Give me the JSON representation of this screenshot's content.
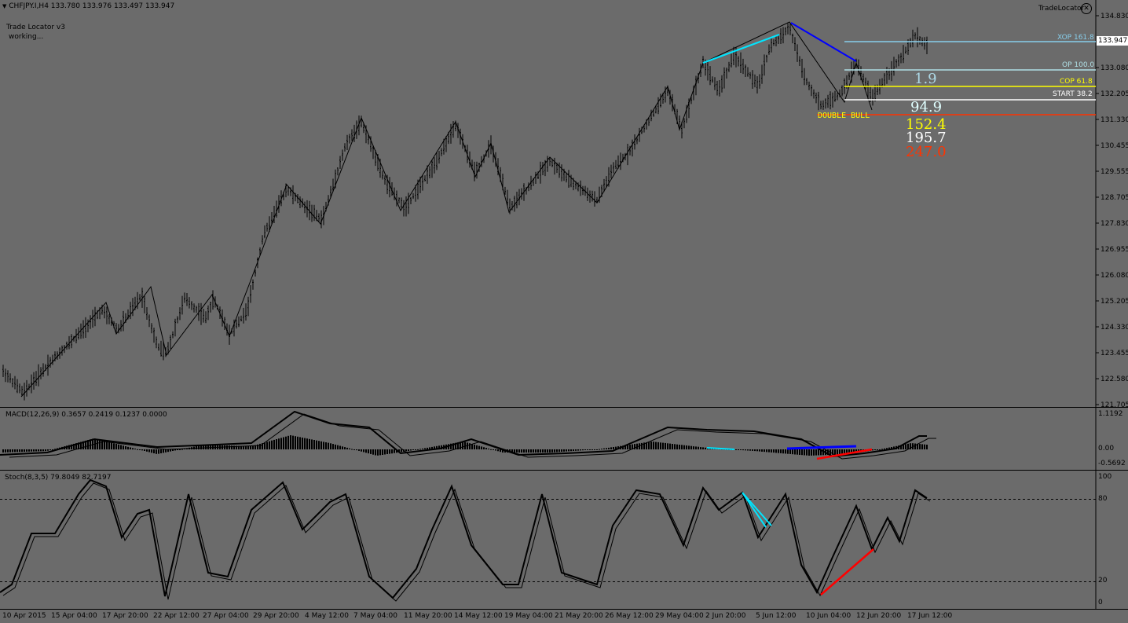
{
  "header": {
    "symbol_line": "CHFJPY.I,H4  133.780 133.976 133.497 133.947",
    "indicator_name": "Trade Locator v3",
    "indicator_status": "working...",
    "tradelocator_label": "TradeLocator"
  },
  "price_axis": {
    "ticks": [
      "134.830",
      "133.080",
      "132.205",
      "131.330",
      "130.455",
      "129.555",
      "128.705",
      "127.830",
      "126.955",
      "126.080",
      "125.205",
      "124.330",
      "123.455",
      "122.580",
      "121.705"
    ],
    "current_price": "133.947",
    "current_price_bg": "#ffffff"
  },
  "levels": [
    {
      "label": "XOP 161.8",
      "color": "#87ceeb"
    },
    {
      "label": "OP 100.0",
      "color": "#b0e0e6"
    },
    {
      "label": "COP 61.8",
      "color": "#ffff00"
    },
    {
      "label": "START 38.2",
      "color": "#ffffff"
    },
    {
      "label": "",
      "color": "#ff3300"
    }
  ],
  "pattern_label": "DOUBLE BULL",
  "pattern_label_color": "#ffff00",
  "projections": [
    {
      "text": "1.9",
      "color": "#add8e6"
    },
    {
      "text": "94.9",
      "color": "#e0ffff"
    },
    {
      "text": "152.4",
      "color": "#ffff00"
    },
    {
      "text": "195.7",
      "color": "#ffffff"
    },
    {
      "text": "247.0",
      "color": "#ff3300"
    }
  ],
  "macd": {
    "title": "MACD(12,26,9) 0.3657 0.2419 0.1237 0.0000",
    "axis": [
      "1.1192",
      "0.00",
      "-0.5692"
    ]
  },
  "stoch": {
    "title": "Stoch(8,3,5) 79.8049 82.7197",
    "axis": [
      "100",
      "80",
      "20",
      "0"
    ]
  },
  "time_axis": [
    "10 Apr 2015",
    "15 Apr 04:00",
    "17 Apr 20:00",
    "22 Apr 12:00",
    "27 Apr 04:00",
    "29 Apr 20:00",
    "4 May 12:00",
    "7 May 04:00",
    "11 May 20:00",
    "14 May 12:00",
    "19 May 04:00",
    "21 May 20:00",
    "26 May 12:00",
    "29 May 04:00",
    "2 Jun 20:00",
    "5 Jun 12:00",
    "10 Jun 04:00",
    "12 Jun 20:00",
    "17 Jun 12:00"
  ],
  "colors": {
    "background": "#6b6b6b",
    "bars": "#000000",
    "divergence_cyan": "#00e5ff",
    "divergence_blue": "#0000ff",
    "divergence_red": "#ff0000"
  }
}
